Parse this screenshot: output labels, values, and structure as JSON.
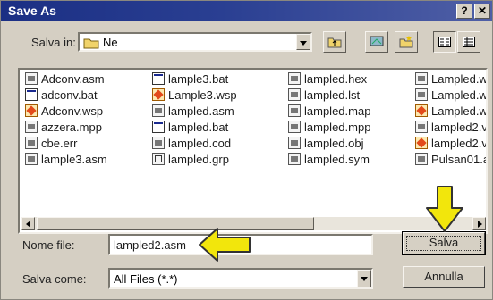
{
  "window": {
    "title": "Save As",
    "help_label": "?",
    "close_label": "✕"
  },
  "save_in": {
    "label": "Salva in:",
    "value": "Ne"
  },
  "files": [
    {
      "name": "Adconv.asm",
      "icon": "doc"
    },
    {
      "name": "adconv.bat",
      "icon": "bat"
    },
    {
      "name": "Adconv.wsp",
      "icon": "wsp"
    },
    {
      "name": "azzera.mpp",
      "icon": "doc"
    },
    {
      "name": "cbe.err",
      "icon": "doc"
    },
    {
      "name": "lample3.asm",
      "icon": "doc"
    },
    {
      "name": "lample3.bat",
      "icon": "bat"
    },
    {
      "name": "Lample3.wsp",
      "icon": "wsp"
    },
    {
      "name": "lampled.asm",
      "icon": "doc"
    },
    {
      "name": "lampled.bat",
      "icon": "bat"
    },
    {
      "name": "lampled.cod",
      "icon": "doc"
    },
    {
      "name": "lampled.grp",
      "icon": "grp"
    },
    {
      "name": "lampled.hex",
      "icon": "doc"
    },
    {
      "name": "lampled.lst",
      "icon": "doc"
    },
    {
      "name": "lampled.map",
      "icon": "doc"
    },
    {
      "name": "lampled.mpp",
      "icon": "doc"
    },
    {
      "name": "lampled.obj",
      "icon": "doc"
    },
    {
      "name": "lampled.sym",
      "icon": "doc"
    },
    {
      "name": "Lampled.w",
      "icon": "doc"
    },
    {
      "name": "Lampled.w",
      "icon": "doc"
    },
    {
      "name": "Lampled.w",
      "icon": "wsp"
    },
    {
      "name": "lampled2.v",
      "icon": "doc"
    },
    {
      "name": "lampled2.v",
      "icon": "wsp"
    },
    {
      "name": "Pulsan01.a",
      "icon": "doc"
    }
  ],
  "filename": {
    "label": "Nome file:",
    "value": "lampled2.asm"
  },
  "save_as_type": {
    "label": "Salva come:",
    "value": "All Files (*.*)"
  },
  "buttons": {
    "save": "Salva",
    "cancel": "Annulla"
  },
  "colors": {
    "title_bar": "#1b2f84",
    "dialog_bg": "#d6d0c4",
    "annotation_arrow": "#f2e60c"
  }
}
